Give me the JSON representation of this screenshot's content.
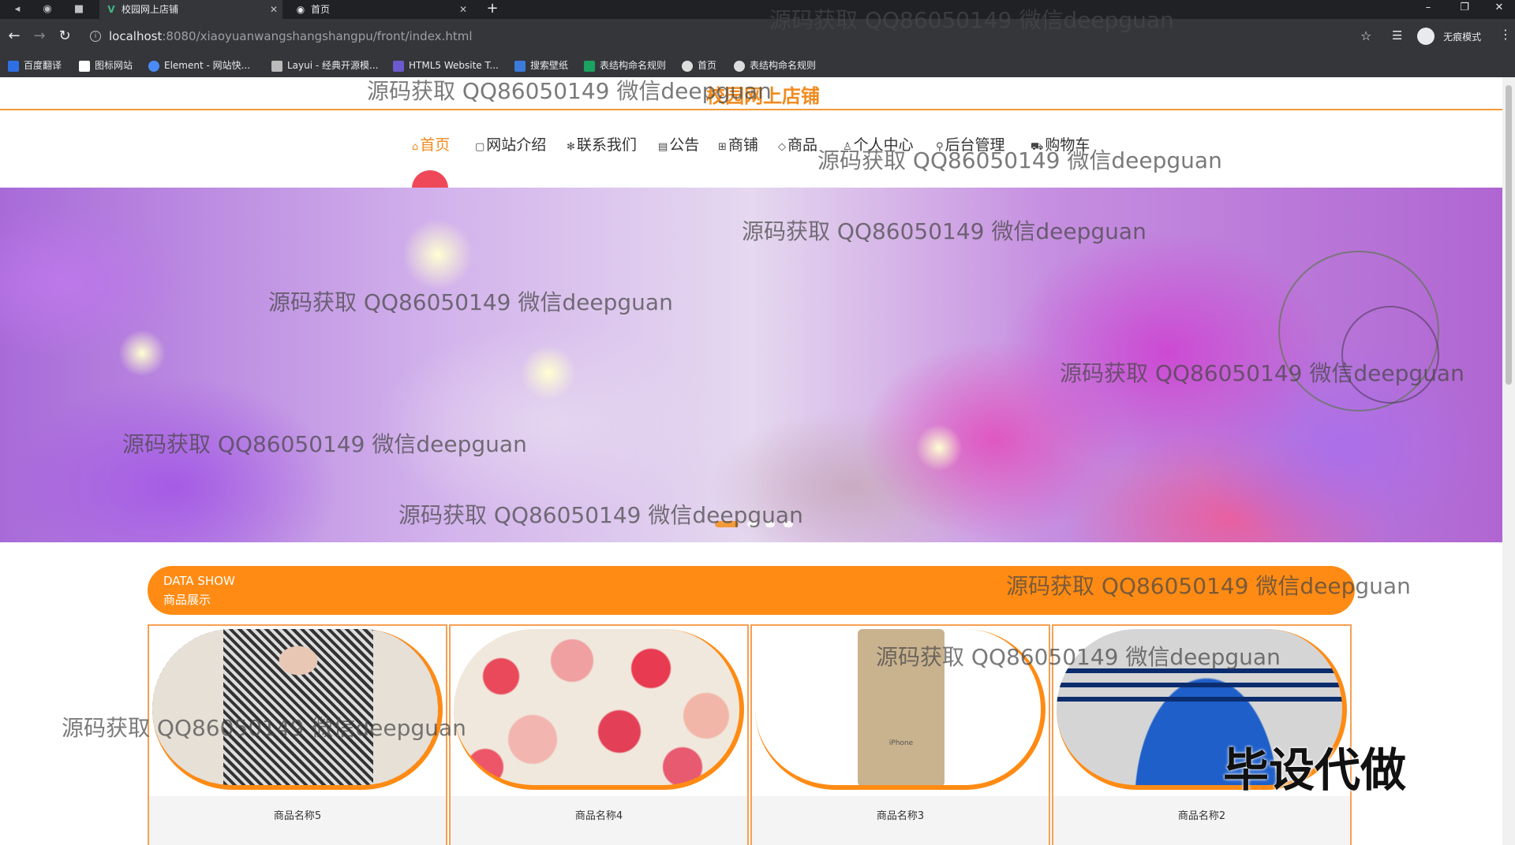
{
  "browser": {
    "tabs": [
      {
        "label": "校园网上店铺",
        "active": true
      },
      {
        "label": "首页",
        "active": false
      }
    ],
    "url_host": "localhost",
    "url_rest": ":8080/xiaoyuanwangshangshangpu/front/index.html",
    "profile_label": "无痕模式",
    "bookmarks": [
      {
        "label": "百度翻译",
        "color": "#2f6fe4"
      },
      {
        "label": "图标网站",
        "color": "#ffffff"
      },
      {
        "label": "Element - 网站快...",
        "color": "#4a8cf7"
      },
      {
        "label": "Layui - 经典开源模...",
        "color": "#bbbbbb"
      },
      {
        "label": "HTML5 Website T...",
        "color": "#6a5acd"
      },
      {
        "label": "搜索壁纸",
        "color": "#3b7bd9"
      },
      {
        "label": "表结构命名规则",
        "color": "#1aa260"
      },
      {
        "label": "首页",
        "color": "#dddddd"
      },
      {
        "label": "表结构命名规则",
        "color": "#dddddd"
      }
    ]
  },
  "site": {
    "title": "校园网上店铺",
    "nav": [
      {
        "label": "首页",
        "icon": "home-icon",
        "glyph": "⌂",
        "active": true
      },
      {
        "label": "网站介绍",
        "icon": "doc-icon",
        "glyph": "▢",
        "active": false
      },
      {
        "label": "联系我们",
        "icon": "contact-icon",
        "glyph": "✻",
        "active": false
      },
      {
        "label": "公告",
        "icon": "notice-icon",
        "glyph": "▤",
        "active": false
      },
      {
        "label": "商铺",
        "icon": "shop-icon",
        "glyph": "⊞",
        "active": false
      },
      {
        "label": "商品",
        "icon": "tag-icon",
        "glyph": "◇",
        "active": false
      },
      {
        "label": "个人中心",
        "icon": "user-icon",
        "glyph": "♙",
        "active": false
      },
      {
        "label": "后台管理",
        "icon": "link-icon",
        "glyph": "⚲",
        "active": false
      },
      {
        "label": "购物车",
        "icon": "cart-icon",
        "glyph": "⛟",
        "active": false
      }
    ],
    "carousel": {
      "slides": 4,
      "active_index": 0
    },
    "section": {
      "en": "DATA SHOW",
      "cn": "商品展示"
    },
    "products": [
      {
        "name": "商品名称5",
        "image": "gingham-dress"
      },
      {
        "name": "商品名称4",
        "image": "rose-bouquet"
      },
      {
        "name": "商品名称3",
        "image": "iphone-box",
        "image_text": "iPhone"
      },
      {
        "name": "商品名称2",
        "image": "blue-sweater"
      }
    ]
  },
  "overlay": {
    "watermark": "源码获取 QQ86050149 微信deepguan",
    "stamp": "毕设代做"
  },
  "colors": {
    "accent": "#ff8b14",
    "nav_active": "#f08a1e"
  }
}
